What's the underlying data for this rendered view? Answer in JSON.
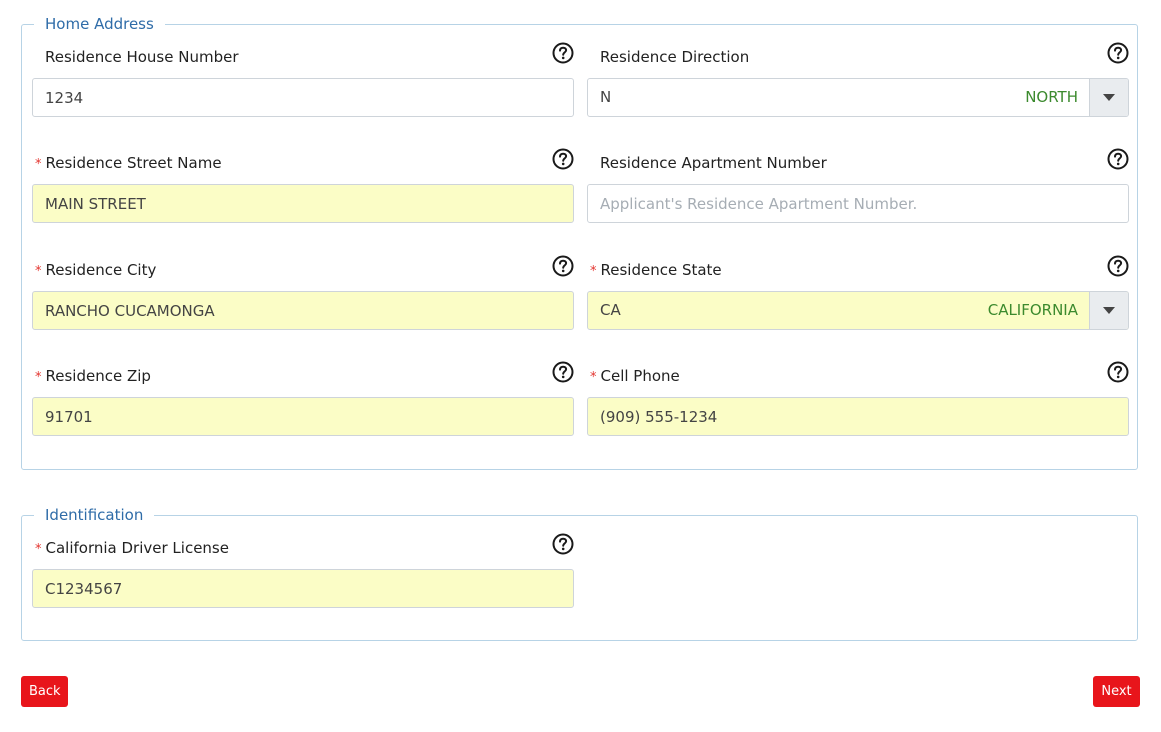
{
  "home_address": {
    "legend": "Home Address",
    "house_number": {
      "label": "Residence House Number",
      "value": "1234"
    },
    "direction": {
      "label": "Residence Direction",
      "code": "N",
      "description": "NORTH"
    },
    "street_name": {
      "label": "Residence Street Name",
      "value": "MAIN STREET"
    },
    "apartment_number": {
      "label": "Residence Apartment Number",
      "value": "",
      "placeholder": "Applicant's Residence Apartment Number."
    },
    "city": {
      "label": "Residence City",
      "value": "RANCHO CUCAMONGA"
    },
    "state": {
      "label": "Residence State",
      "code": "CA",
      "description": "CALIFORNIA"
    },
    "zip": {
      "label": "Residence Zip",
      "value": "91701"
    },
    "cell_phone": {
      "label": "Cell Phone",
      "value": "(909) 555-1234"
    }
  },
  "identification": {
    "legend": "Identification",
    "driver_license": {
      "label": "California Driver License",
      "value": "C1234567"
    }
  },
  "buttons": {
    "back": "Back",
    "next": "Next"
  },
  "colors": {
    "accent_blue": "#2f6ca8",
    "required_red": "#e3342f",
    "highlight_yellow": "#fbfdc6",
    "description_green": "#3c8a2e",
    "button_red": "#e8151b"
  },
  "icons": {
    "help": "question-circle-icon",
    "dropdown": "caret-down-icon"
  }
}
